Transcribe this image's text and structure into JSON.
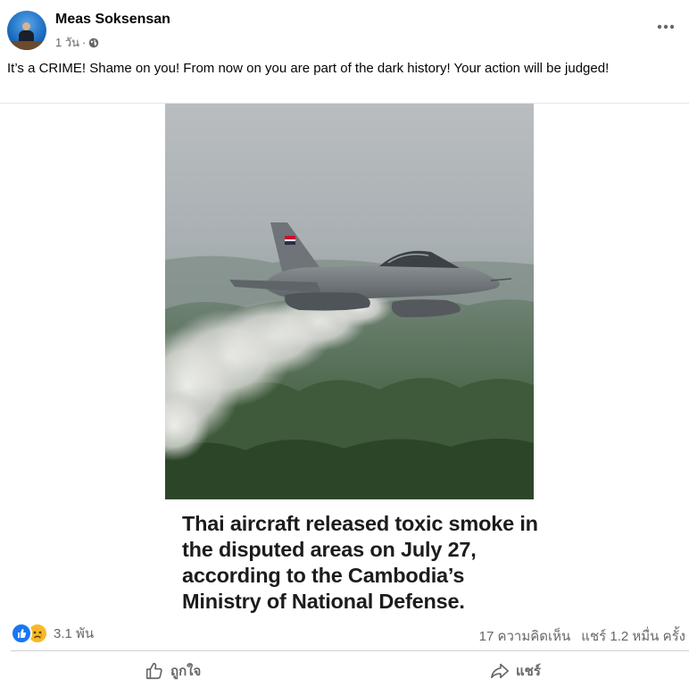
{
  "post": {
    "author": "Meas Soksensan",
    "time": "1 วัน",
    "separator": "·",
    "privacy_icon": "globe-icon",
    "caption": "It’s a CRIME! Shame on you! From now on you are part of the dark history! Your action will be judged!",
    "image_headline": "Thai aircraft released toxic smoke in the disputed areas on July 27, according to the Cambodia’s Ministry of National Defense."
  },
  "reactions": {
    "icons": [
      "like-reaction-icon",
      "sad-reaction-icon"
    ],
    "count": "3.1 พัน",
    "comments": "17 ความคิดเห็น",
    "shares": "แชร์ 1.2 หมื่น ครั้ง"
  },
  "actions": {
    "like_label": "ถูกใจ",
    "share_label": "แชร์"
  },
  "colors": {
    "like_blue": "#1877f2",
    "sad_yellow": "#f7b928",
    "muted_text": "#65676b"
  }
}
